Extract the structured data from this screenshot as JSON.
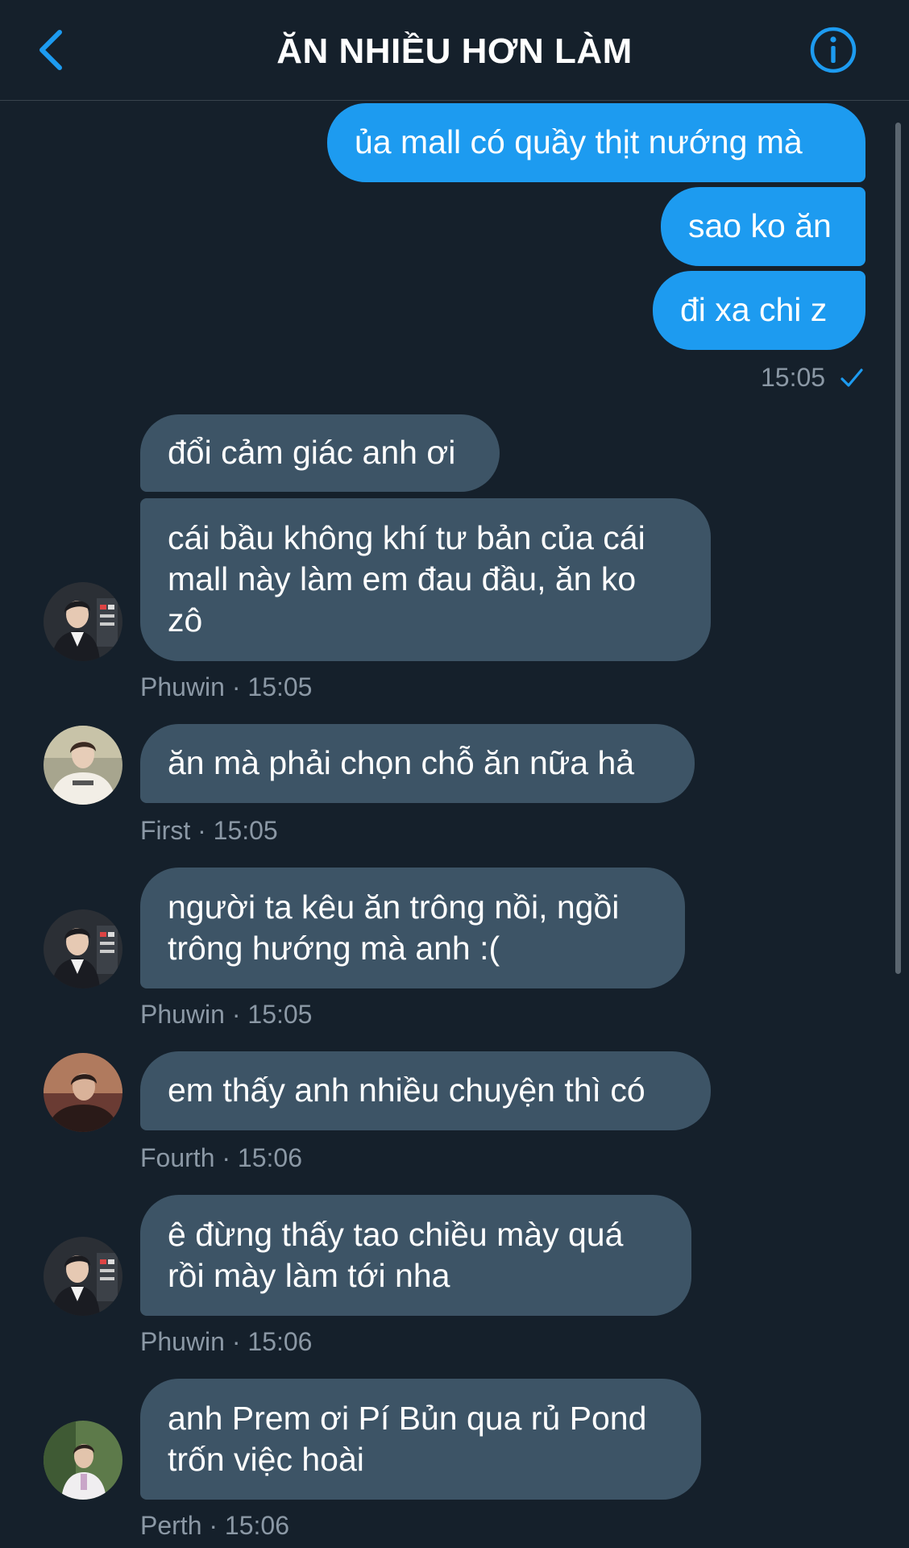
{
  "header": {
    "title": "ĂN NHIỀU HƠN LÀM"
  },
  "messages_out": [
    {
      "text": "ủa mall có quầy thịt nướng mà"
    },
    {
      "text": "sao ko ăn"
    },
    {
      "text": "đi xa chi z"
    }
  ],
  "out_meta": {
    "time": "15:05",
    "status_icon": "check-icon"
  },
  "messages_in": [
    {
      "lines": [
        "đổi cảm giác anh ơi"
      ]
    },
    {
      "lines": [
        "cái bầu không khí tư bản của cái",
        "mall này làm em đau đầu, ăn ko",
        "zô"
      ],
      "meta": "Phuwin · 15:05"
    },
    {
      "lines": [
        "ăn mà phải chọn chỗ ăn nữa hả"
      ],
      "meta": "First · 15:05"
    },
    {
      "lines": [
        "người ta kêu ăn trông nồi, ngồi",
        "trông hướng mà anh :("
      ],
      "meta": "Phuwin · 15:05"
    },
    {
      "lines": [
        "em thấy anh nhiều chuyện thì có"
      ],
      "meta": "Fourth · 15:06"
    },
    {
      "lines": [
        "ê đừng thấy tao chiều mày quá",
        "rồi mày làm tới nha"
      ],
      "meta": "Phuwin · 15:06"
    },
    {
      "lines": [
        "anh Prem ơi Pí Bủn qua rủ Pond",
        "trốn việc hoài"
      ],
      "meta": "Perth · 15:06"
    }
  ],
  "colors": {
    "background": "#15202b",
    "outgoing_bubble": "#1d9bf0",
    "incoming_bubble": "#3d5466",
    "meta_text": "#8b98a5",
    "accent": "#1d9bf0"
  }
}
